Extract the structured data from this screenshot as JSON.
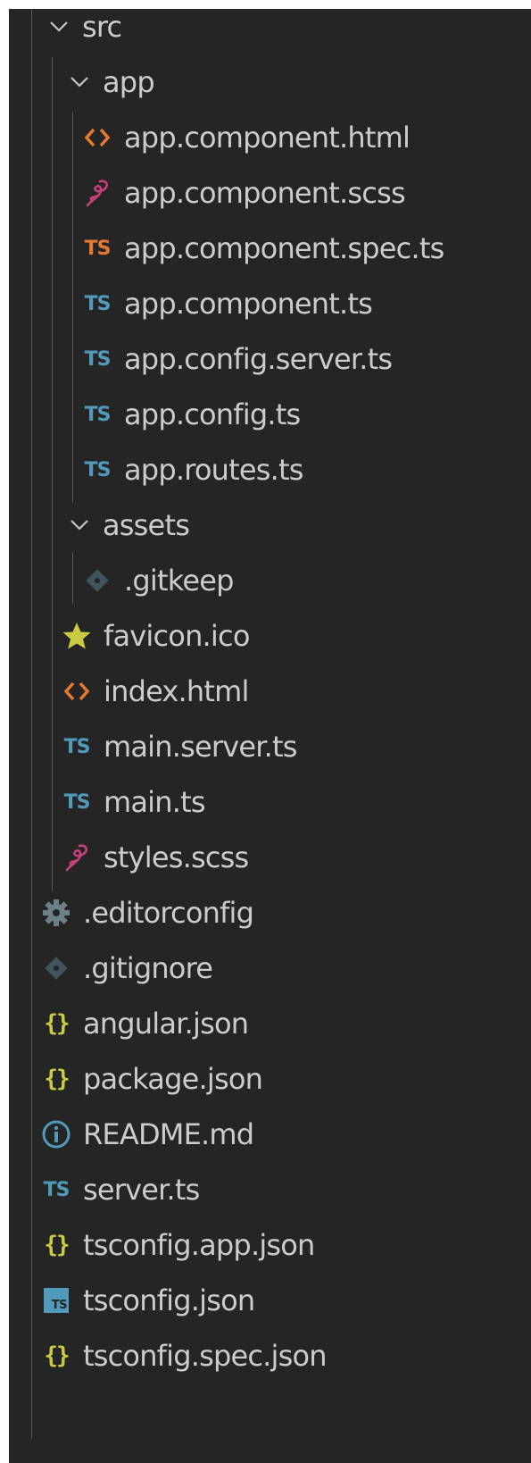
{
  "explorer": {
    "colors": {
      "background": "#252526",
      "text": "#cccccc",
      "ts_blue": "#519aba",
      "ts_orange": "#e37933",
      "html_orange": "#e37933",
      "scss_pink": "#c5407d",
      "json_yellow": "#cbcb41",
      "git_gray": "#41535b",
      "gear_gray": "#6d8086",
      "star_yellow": "#cbcb41",
      "info_blue": "#519aba"
    },
    "items": [
      {
        "label": "src",
        "icon": "chevron-down-icon"
      },
      {
        "label": "app",
        "icon": "chevron-down-icon"
      },
      {
        "label": "app.component.html",
        "icon": "html-file-icon"
      },
      {
        "label": "app.component.scss",
        "icon": "scss-file-icon"
      },
      {
        "label": "app.component.spec.ts",
        "icon": "ts-spec-file-icon",
        "icon_text": "TS"
      },
      {
        "label": "app.component.ts",
        "icon": "ts-file-icon",
        "icon_text": "TS"
      },
      {
        "label": "app.config.server.ts",
        "icon": "ts-file-icon",
        "icon_text": "TS"
      },
      {
        "label": "app.config.ts",
        "icon": "ts-file-icon",
        "icon_text": "TS"
      },
      {
        "label": "app.routes.ts",
        "icon": "ts-file-icon",
        "icon_text": "TS"
      },
      {
        "label": "assets",
        "icon": "chevron-down-icon"
      },
      {
        "label": ".gitkeep",
        "icon": "git-file-icon"
      },
      {
        "label": "favicon.ico",
        "icon": "star-icon"
      },
      {
        "label": "index.html",
        "icon": "html-file-icon"
      },
      {
        "label": "main.server.ts",
        "icon": "ts-file-icon",
        "icon_text": "TS"
      },
      {
        "label": "main.ts",
        "icon": "ts-file-icon",
        "icon_text": "TS"
      },
      {
        "label": "styles.scss",
        "icon": "scss-file-icon"
      },
      {
        "label": ".editorconfig",
        "icon": "gear-icon"
      },
      {
        "label": ".gitignore",
        "icon": "git-file-icon"
      },
      {
        "label": "angular.json",
        "icon": "json-file-icon"
      },
      {
        "label": "package.json",
        "icon": "json-file-icon"
      },
      {
        "label": "README.md",
        "icon": "info-icon"
      },
      {
        "label": "server.ts",
        "icon": "ts-file-icon",
        "icon_text": "TS"
      },
      {
        "label": "tsconfig.app.json",
        "icon": "json-file-icon"
      },
      {
        "label": "tsconfig.json",
        "icon": "tsconfig-file-icon",
        "icon_text": "TS"
      },
      {
        "label": "tsconfig.spec.json",
        "icon": "json-file-icon"
      }
    ]
  }
}
